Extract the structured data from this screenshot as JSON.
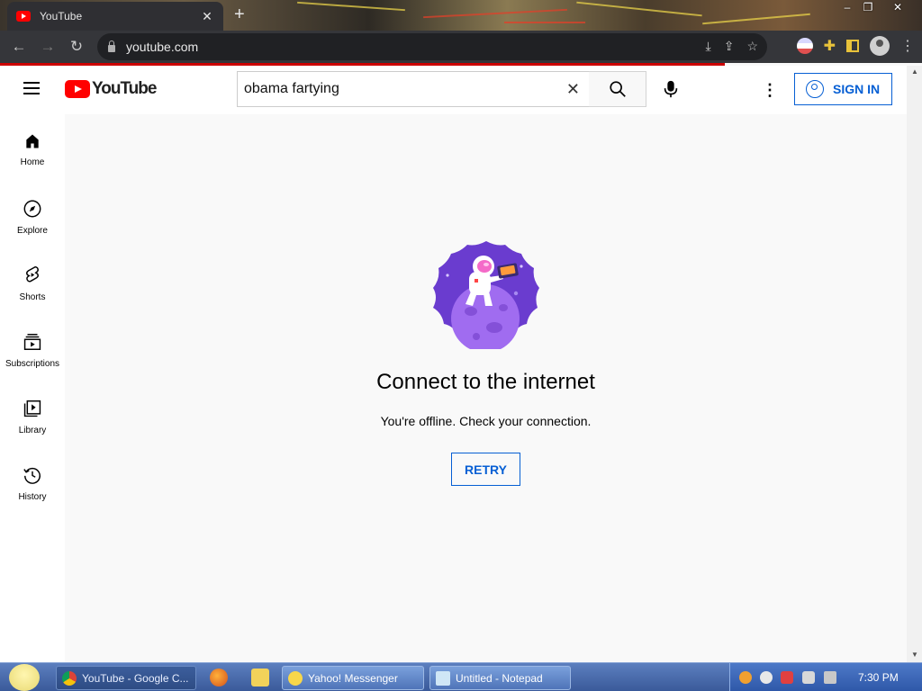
{
  "browser": {
    "tab_title": "YouTube",
    "tab_close": "✕",
    "new_tab": "+",
    "url": "youtube.com",
    "window_controls": [
      "–",
      "❐",
      "✕"
    ]
  },
  "masthead": {
    "logo_text": "YouTube",
    "search_value": "obama fartying",
    "search_placeholder": "Search",
    "signin_label": "SIGN IN"
  },
  "guide": {
    "items": [
      {
        "label": "Home",
        "icon": "home-icon"
      },
      {
        "label": "Explore",
        "icon": "compass-icon"
      },
      {
        "label": "Shorts",
        "icon": "shorts-icon"
      },
      {
        "label": "Subscriptions",
        "icon": "subscriptions-icon"
      },
      {
        "label": "Library",
        "icon": "library-icon"
      },
      {
        "label": "History",
        "icon": "history-icon"
      }
    ]
  },
  "offline": {
    "title": "Connect to the internet",
    "message": "You're offline. Check your connection.",
    "retry_label": "RETRY"
  },
  "taskbar": {
    "tasks": [
      {
        "label": "YouTube - Google C...",
        "icon": "chrome-icon"
      },
      {
        "label": "Yahoo! Messenger",
        "icon": "yahoo-messenger-icon"
      },
      {
        "label": "Untitled - Notepad",
        "icon": "notepad-icon"
      }
    ],
    "clock": "7:30 PM"
  },
  "colors": {
    "youtube_red": "#ff0000",
    "link_blue": "#065fd4",
    "chrome_dark": "#35363a",
    "taskbar_blue": "#3a5a9a"
  }
}
